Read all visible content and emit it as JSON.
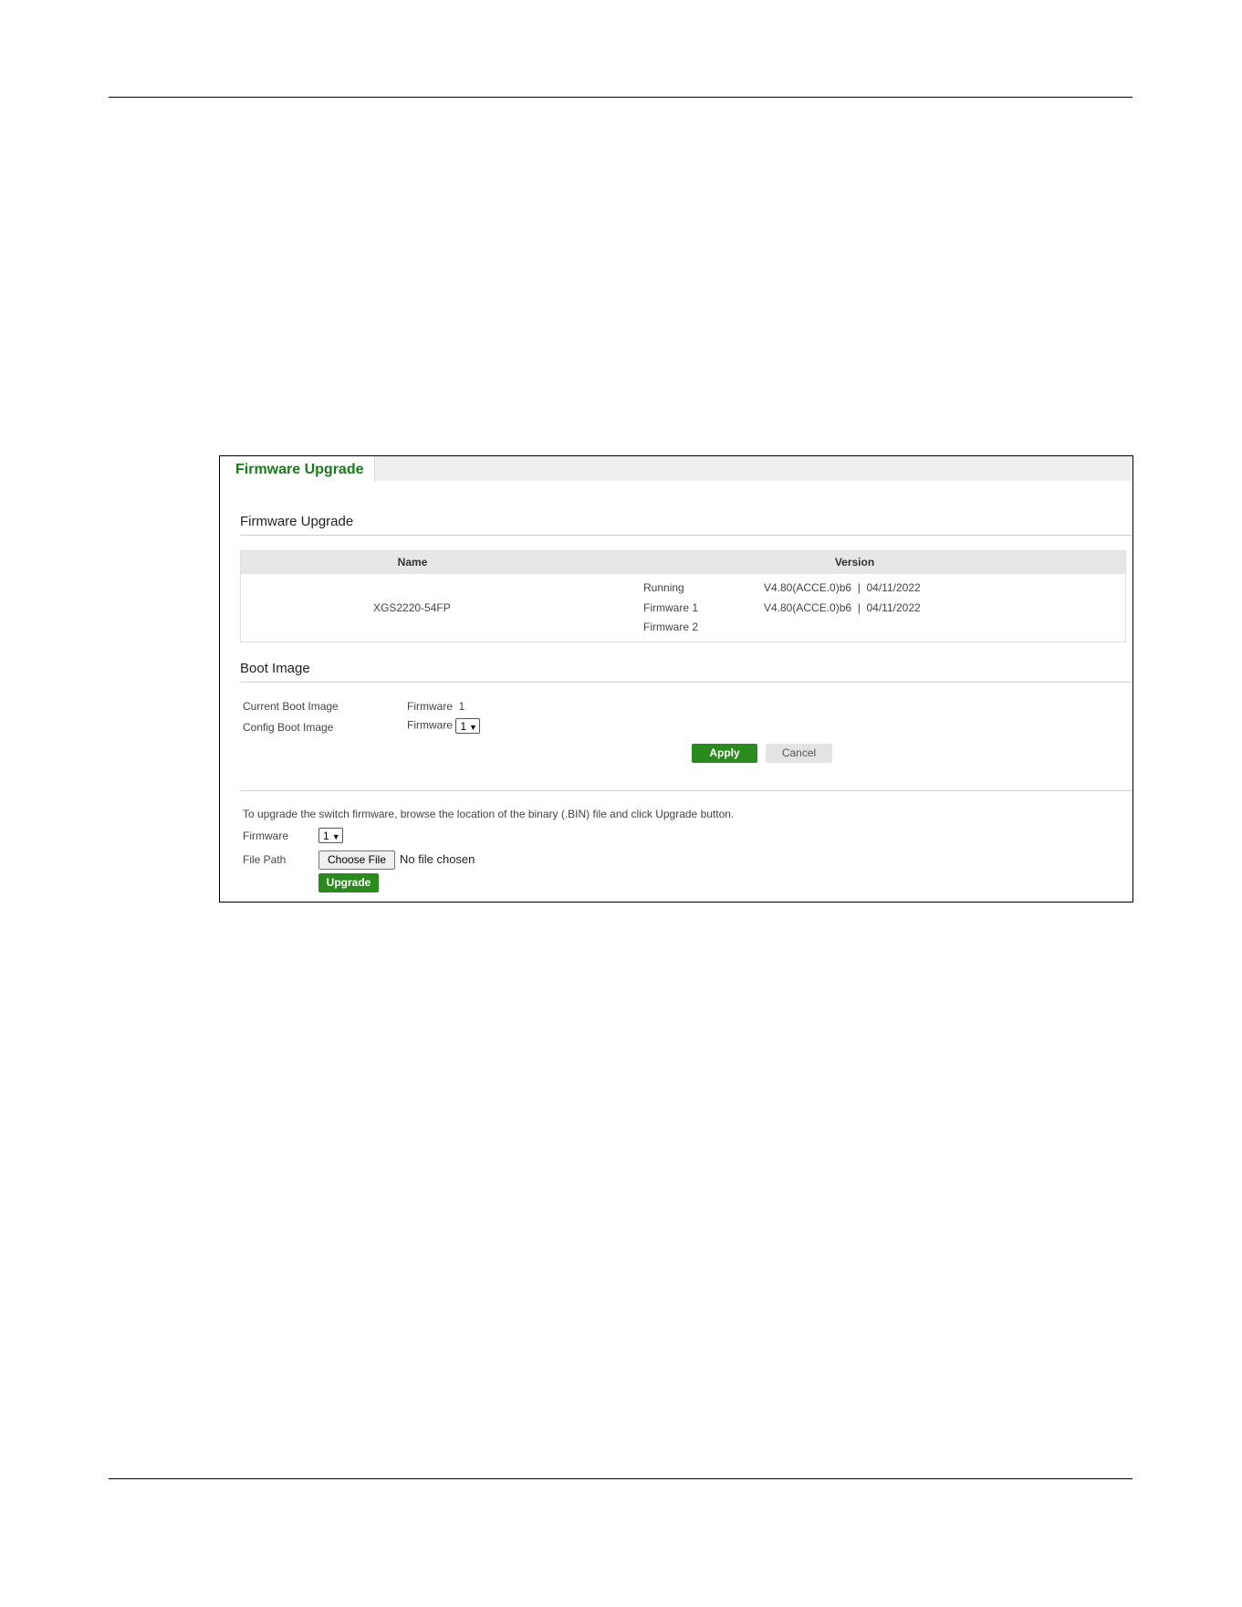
{
  "tab": {
    "label": "Firmware Upgrade"
  },
  "firmware_section": {
    "title": "Firmware Upgrade",
    "columns": {
      "name": "Name",
      "version": "Version"
    },
    "row": {
      "name": "XGS2220-54FP",
      "entries": [
        {
          "label": "Running",
          "version": "V4.80(ACCE.0)b6  |  04/11/2022"
        },
        {
          "label": "Firmware 1",
          "version": "V4.80(ACCE.0)b6  |  04/11/2022"
        },
        {
          "label": "Firmware 2",
          "version": ""
        }
      ]
    }
  },
  "boot_section": {
    "title": "Boot Image",
    "current_label": "Current Boot Image",
    "current_value": "Firmware  1",
    "config_label": "Config Boot Image",
    "config_prefix": "Firmware",
    "config_selected": "1",
    "apply_label": "Apply",
    "cancel_label": "Cancel"
  },
  "upgrade_section": {
    "instructions": "To upgrade the switch firmware, browse the location of the binary (.BIN) file and click Upgrade button.",
    "firmware_label": "Firmware",
    "firmware_selected": "1",
    "file_path_label": "File Path",
    "choose_file_label": "Choose File",
    "file_status": "No file chosen",
    "upgrade_label": "Upgrade"
  },
  "colors": {
    "accent_green": "#2b8a1e",
    "tab_text_green": "#1a7a1a"
  }
}
